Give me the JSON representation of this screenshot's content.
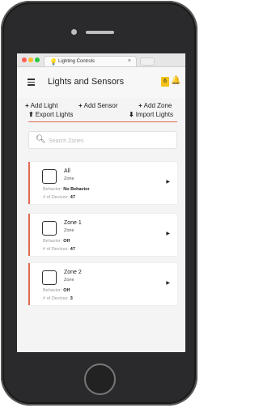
{
  "browser": {
    "tab_title": "Lighting Controls",
    "tab_close": "×",
    "tab_icon": "lightbulb-icon"
  },
  "header": {
    "title": "Lights and Sensors",
    "notification_count": "6"
  },
  "actions": {
    "add_light": "Add Light",
    "add_sensor": "Add Sensor",
    "add_zone": "Add Zone",
    "export_lights": "Export Lights",
    "import_lights": "Import Lights"
  },
  "search": {
    "placeholder": "Search Zones",
    "value": ""
  },
  "zones": [
    {
      "name": "All",
      "type": "Zone",
      "behavior_label": "Behavior:",
      "behavior": "No Behavior",
      "devices_label": "# of Devices:",
      "devices": "47"
    },
    {
      "name": "Zone 1",
      "type": "Zone",
      "behavior_label": "Behavior:",
      "behavior": "Off",
      "devices_label": "# of Devices:",
      "devices": "47"
    },
    {
      "name": "Zone 2",
      "type": "Zone",
      "behavior_label": "Behavior:",
      "behavior": "Off",
      "devices_label": "# of Devices:",
      "devices": "3"
    }
  ],
  "colors": {
    "accent": "#e06a55",
    "badge": "#f3c317"
  }
}
